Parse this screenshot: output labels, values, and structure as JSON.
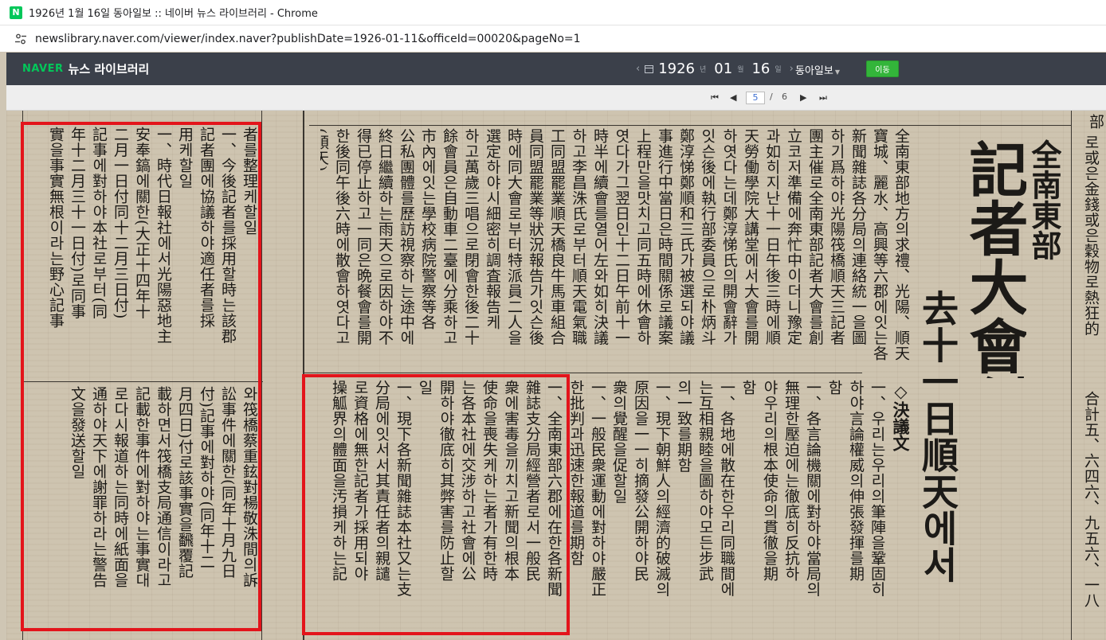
{
  "window": {
    "favicon": "N",
    "title": "1926년 1월 16일 동아일보 :: 네이버 뉴스 라이브러리 - Chrome"
  },
  "address": {
    "icon": "tune-icon",
    "url": "newslibrary.naver.com/viewer/index.naver?publishDate=1926-01-11&officeId=00020&pageNo=1"
  },
  "header": {
    "logo": "NAVER",
    "title": "뉴스 라이브러리",
    "year": "1926",
    "year_unit": "년",
    "month": "01",
    "month_unit": "월",
    "day": "16",
    "day_unit": "일",
    "paper": "동아일보",
    "go_button": "이동"
  },
  "pager": {
    "current": "5",
    "separator": "/",
    "total": "6"
  },
  "article": {
    "headline_region": "全南東部",
    "headline_main": "記者大會創立",
    "headline_date": "去十一日順天에서",
    "resolution_label": "◇決議文",
    "top_columns": [
      "全南東部地方의求禮、光陽、順天",
      "寶城、麗水、高興等六郡에잇는各",
      "新聞雜誌各分局의連絡統一을圖",
      "하기爲하야光陽筏橋順天三記者",
      "團主催로全南東部記者大會를創",
      "立코저準備에奔忙中이더니豫定",
      "과如히지난十一日午後三時에順",
      "天勞働學院大講堂에서大會를開",
      "하엿다는데鄭淳悌氏의開會辭가",
      "잇슨後에執行部委員으로朴炳斗",
      "鄭淳悌鄭順和三氏가被選되야議",
      "事進行中當日은時間關係로議案",
      "上程만을맛치고同五時에休會하",
      "엿다가그翌日인十二日午前十一",
      "時半에續會를열어左와如히決議",
      "하고李昌洙氏로부터順天電氣職",
      "工同盟罷業順天橋良牛馬車組合",
      "員同盟罷業等狀況報告가잇슨後",
      "時에同大會로부터特派員二人을",
      "選定하야시細密히調査報告케",
      "하고萬歲三唱으로閉會한後二十",
      "餘會員은自動車二臺에分乘하고",
      "市內에잇는學校病院警察等各",
      "公私團體를歷訪視察하는途中에",
      "終日繼續하는雨天으로因하야不",
      "得已停止하고一同은晩餐會를開",
      "한後同午後六時에散會하엿다고",
      "(順天)"
    ],
    "resolutions": [
      "一、우리는우리의筆陣을鞏固히",
      "하야言論權威의伸張發揮를期",
      "함",
      "一、各言論機關에對하야當局의",
      "無理한壓迫에는徹底히反抗하",
      "야우리의根本使命의貫徹을期",
      "함",
      "一、各地에散在한우리同職間에",
      "는互相親睦을圖하야모든步武",
      "의一致를期함",
      "一、現下朝鮮人의經濟的破滅의",
      "原因을一一히摘發公開하야民",
      "衆의覺醒을促할일",
      "一、一般民衆運動에對하야嚴正",
      "한批判과迅速한報道를期함"
    ],
    "boxed_middle": [
      "一、全南東部六郡에在한各新聞",
      "雜誌支分局經營者로서一般民",
      "衆에害毒을끼치고新聞의根本",
      "使命을喪失케하는者가有한時",
      "는各本社에交涉하고社會에公",
      "開하야徹底히其弊害를防止할",
      "일",
      "一、現下各新聞雜誌本社又는支",
      "分局에잇서서其責任者의親譴",
      "로資格에無한記者가採用되야",
      "操觚界의體面을汚損케하는記"
    ],
    "boxed_left_top": [
      "者를整理케할일",
      "一、今後記者를採用할時는該郡",
      "記者團에協議하야適任者를採",
      "用케할일",
      "一、時代日報社에서光陽惡地主",
      "安奉鎬에關한(大正十四年十",
      "二月一日付同十二月三日付)",
      "記事에對하야本社로부터(同",
      "年十二月三十一日付)로同事",
      "實을事實無根이라는野心記事"
    ],
    "boxed_left_bottom": [
      "와筏橋蔡重鉉對楊敬洙間의訴",
      "訟事件에關한(同年十月九日",
      "付)記事에對하야(同年十二",
      "月四日)付로該事實을飜覆記",
      "載하면서筏橋支局通信이라고",
      "記載한事件에對하야는事實대",
      "로다시報道하는同時에紙面을",
      "通하야天下에謝罪하라는警告",
      "文을發送할일"
    ],
    "right_fragment_top": [
      "로或은金錢或은穀物로熱狂的",
      "部"
    ],
    "right_fragment_numbers": "合計五、六四六、九五六、一八"
  }
}
